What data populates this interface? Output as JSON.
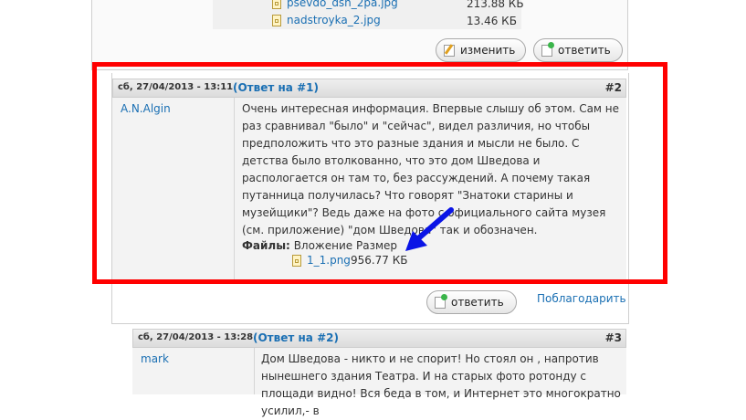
{
  "prev_post": {
    "files": [
      {
        "name": "psevdo_dsh_2pa.jpg",
        "size": "213.88 КБ"
      },
      {
        "name": "nadstroyka_2.jpg",
        "size": "13.46 КБ"
      }
    ],
    "edit_label": "изменить",
    "reply_label": "ответить"
  },
  "post": {
    "date": "сб, 27/04/2013 - 13:11",
    "reply_to": "(Ответ на #1)",
    "number": "#2",
    "author": "A.N.Algin",
    "body": "Очень интересная информация. Впервые слышу об этом. Сам не раз сравнивал \"было\" и \"сейчас\", видел различия, но чтобы предположить что это разные здания и мысли не было. С детства было втолкованно, что это дом Шведова и распологается он там то, без рассуждений. А почему такая путанница получилась? Что говорят \"Знатоки старины и музейщики\"? Ведь даже на фото с официального сайта музея (см. приложение) \"дом Шведова\" так и обозначен.",
    "files_label": "Файлы:",
    "col_attachment": "Вложение",
    "col_size": "Размер",
    "attachment": {
      "name": "1_1.png",
      "size": "956.77 КБ"
    },
    "reply_label": "ответить",
    "thank_label": "Поблагодарить"
  },
  "next_post": {
    "date": "сб, 27/04/2013 - 13:28",
    "reply_to": "(Ответ на #2)",
    "number": "#3",
    "author": "mark",
    "body": "Дом Шведова - никто и не спорит! Но стоял он , напротив нынешнего здания Театра. И на старых фото ротонду с площади видно! Вся беда в том, и Интернет это многократно усилил,- в"
  },
  "colors": {
    "highlight": "#ff0000",
    "arrow": "#0a14e6",
    "link": "#1a6fb3"
  }
}
